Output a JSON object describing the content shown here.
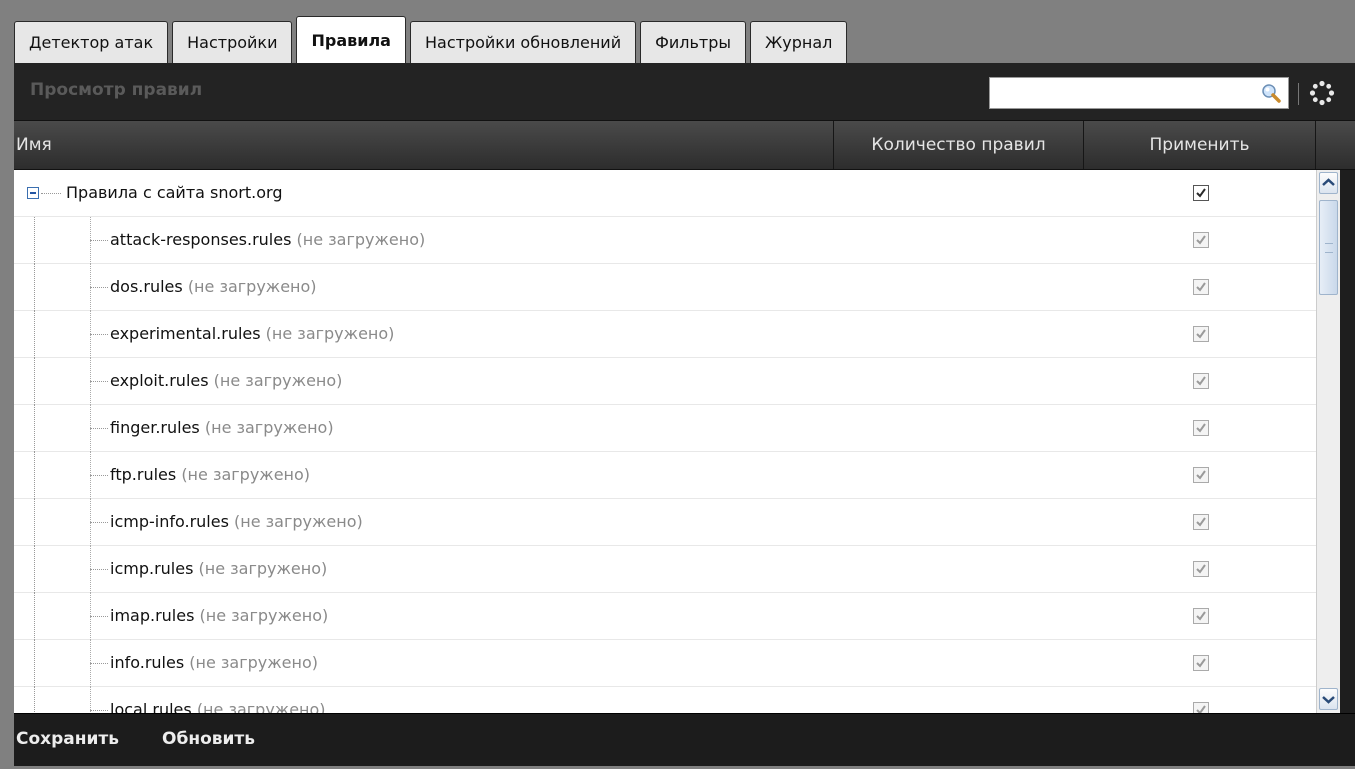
{
  "tabs": [
    {
      "label": "Детектор атак",
      "active": false
    },
    {
      "label": "Настройки",
      "active": false
    },
    {
      "label": "Правила",
      "active": true
    },
    {
      "label": "Настройки обновлений",
      "active": false
    },
    {
      "label": "Фильтры",
      "active": false
    },
    {
      "label": "Журнал",
      "active": false
    }
  ],
  "toolbar": {
    "title": "Просмотр правил",
    "search_value": "",
    "search_icon": "search-icon",
    "settings_icon": "gear-icon"
  },
  "table": {
    "columns": [
      "Имя",
      "Количество правил",
      "Применить"
    ],
    "root": {
      "label": "Правила с сайта snort.org",
      "checked": true,
      "expanded": true
    },
    "rows": [
      {
        "name": "attack-responses.rules",
        "note": "(не загружено)",
        "checked": true
      },
      {
        "name": "dos.rules",
        "note": "(не загружено)",
        "checked": true
      },
      {
        "name": "experimental.rules",
        "note": "(не загружено)",
        "checked": true
      },
      {
        "name": "exploit.rules",
        "note": "(не загружено)",
        "checked": true
      },
      {
        "name": "finger.rules",
        "note": "(не загружено)",
        "checked": true
      },
      {
        "name": "ftp.rules",
        "note": "(не загружено)",
        "checked": true
      },
      {
        "name": "icmp-info.rules",
        "note": "(не загружено)",
        "checked": true
      },
      {
        "name": "icmp.rules",
        "note": "(не загружено)",
        "checked": true
      },
      {
        "name": "imap.rules",
        "note": "(не загружено)",
        "checked": true
      },
      {
        "name": "info.rules",
        "note": "(не загружено)",
        "checked": true
      },
      {
        "name": "local.rules",
        "note": "(не загружено)",
        "checked": true
      }
    ]
  },
  "footer": {
    "save_label": "Сохранить",
    "refresh_label": "Обновить"
  },
  "colors": {
    "panel_bg": "#1e1e1e",
    "header_bg": "#3a3a3a",
    "tab_bg": "#e7e7e7",
    "note_text": "#8a8a8a"
  }
}
